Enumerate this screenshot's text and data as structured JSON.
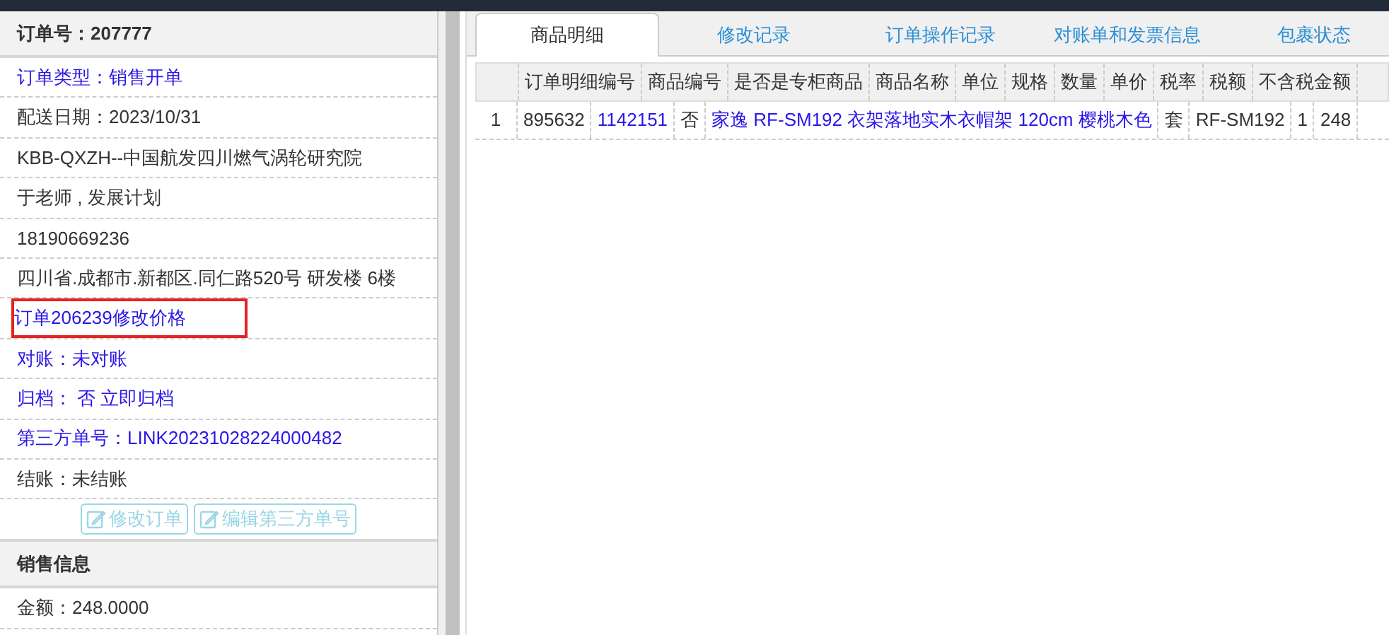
{
  "order_panel": {
    "title": "订单号：207777",
    "fields": [
      {
        "text": "订单类型：销售开单",
        "kind": "link",
        "highlighted": false
      },
      {
        "text": "配送日期：2023/10/31",
        "kind": "plain",
        "highlighted": false
      },
      {
        "text": "KBB-QXZH--中国航发四川燃气涡轮研究院",
        "kind": "plain",
        "highlighted": false
      },
      {
        "text": "于老师 , 发展计划",
        "kind": "plain",
        "highlighted": false
      },
      {
        "text": "18190669236",
        "kind": "plain",
        "highlighted": false
      },
      {
        "text": "四川省.成都市.新都区.同仁路520号 研发楼 6楼",
        "kind": "plain",
        "highlighted": false
      },
      {
        "text": "订单206239修改价格",
        "kind": "link",
        "highlighted": true
      },
      {
        "text": "对账：未对账",
        "kind": "link",
        "highlighted": false
      },
      {
        "text": "归档： 否 立即归档",
        "kind": "link",
        "highlighted": false
      },
      {
        "text": "第三方单号：LINK20231028224000482",
        "kind": "link",
        "highlighted": false
      },
      {
        "text": "结账：未结账",
        "kind": "plain",
        "highlighted": false
      }
    ],
    "buttons": [
      {
        "label": "修改订单",
        "disabled": true
      },
      {
        "label": "编辑第三方单号",
        "disabled": true
      }
    ],
    "sales_section": {
      "title": "销售信息",
      "fields": [
        "金额：248.0000"
      ]
    }
  },
  "tabs": [
    {
      "label": "商品明细",
      "selected": true
    },
    {
      "label": "修改记录",
      "selected": false
    },
    {
      "label": "订单操作记录",
      "selected": false
    },
    {
      "label": "对账单和发票信息",
      "selected": false
    },
    {
      "label": "包裹状态",
      "selected": false
    }
  ],
  "header_grid": {
    "cells": [
      "",
      "订单明细编号",
      "商品编号",
      "是否是专柜商品",
      "商品名称",
      "单位",
      "规格",
      "数量",
      "单价",
      "税率",
      "税额",
      "不含税金额"
    ]
  },
  "body_grid": {
    "rows": [
      {
        "cells": [
          {
            "text": "1",
            "kind": "index"
          },
          {
            "text": "895632",
            "kind": "plain"
          },
          {
            "text": "1142151",
            "kind": "link"
          },
          {
            "text": "否",
            "kind": "plain"
          },
          {
            "text": "家逸 RF-SM192 衣架落地实木衣帽架 120cm 樱桃木色",
            "kind": "link"
          },
          {
            "text": "套",
            "kind": "plain"
          },
          {
            "text": "RF-SM192",
            "kind": "plain"
          },
          {
            "text": "1",
            "kind": "plain"
          },
          {
            "text": "248",
            "kind": "plain"
          }
        ]
      }
    ]
  }
}
